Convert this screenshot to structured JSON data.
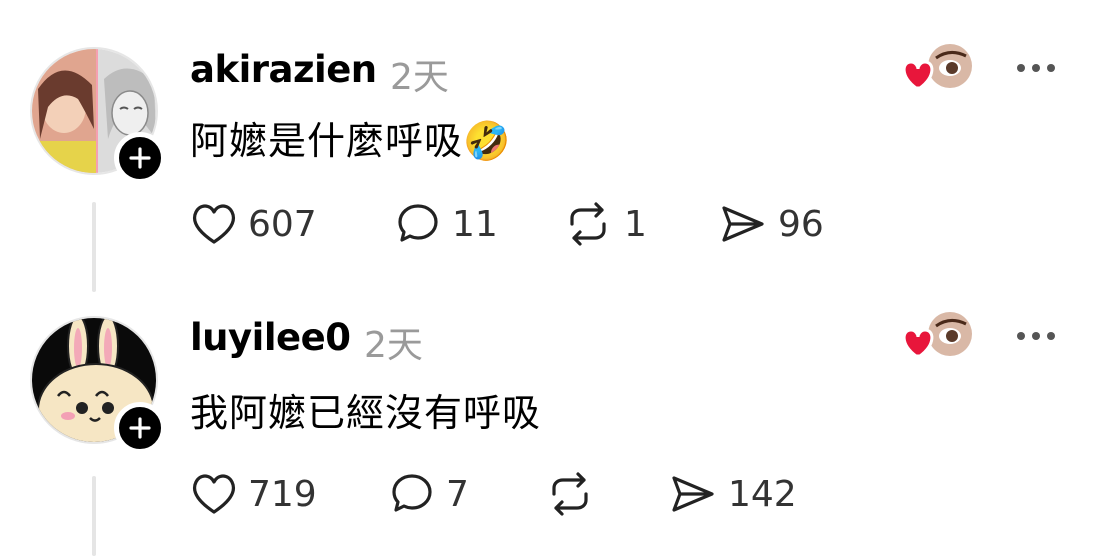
{
  "posts": [
    {
      "username": "akirazien",
      "time": "2天",
      "text": "阿嬤是什麼呼吸🤣",
      "likes": "607",
      "replies": "11",
      "reposts": "1",
      "shares": "96",
      "avatar_icon": "avatar-photo-collage-icon"
    },
    {
      "username": "luyilee0",
      "time": "2天",
      "text": "我阿嬤已經沒有呼吸",
      "likes": "719",
      "replies": "7",
      "reposts": "",
      "shares": "142",
      "avatar_icon": "avatar-bunny-icon"
    }
  ],
  "colors": {
    "heart_red": "#e8163b",
    "muted": "#9a9a9a",
    "thread_line": "#e5e5e5"
  }
}
